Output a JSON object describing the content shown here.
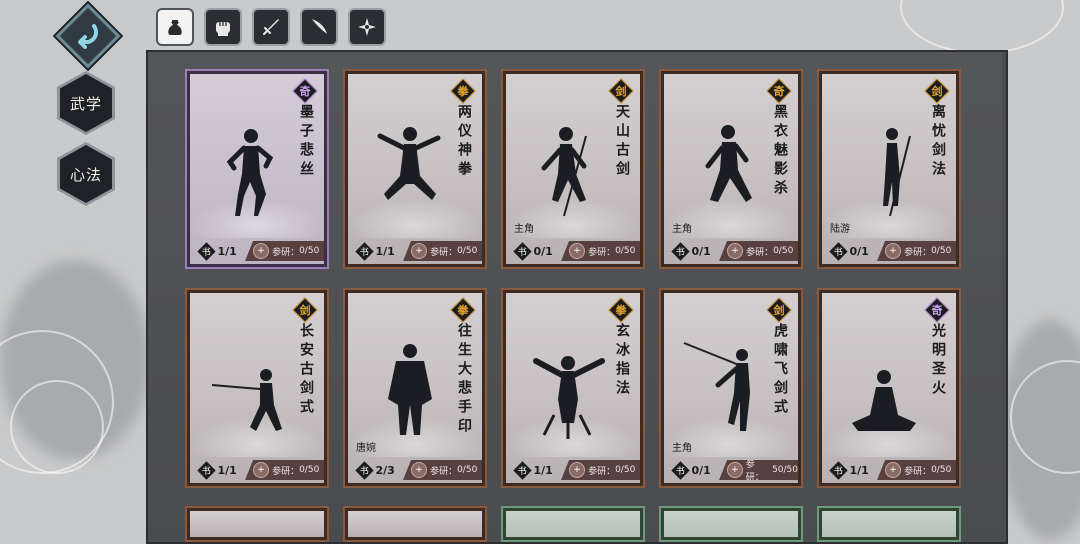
{
  "back_button": {
    "icon": "back-arrow-icon"
  },
  "filters": [
    {
      "icon": "pouch-icon",
      "selected": true
    },
    {
      "icon": "fist-icon",
      "selected": false
    },
    {
      "icon": "sword-icon",
      "selected": false
    },
    {
      "icon": "blade-icon",
      "selected": false
    },
    {
      "icon": "shuriken-icon",
      "selected": false
    }
  ],
  "categories": [
    {
      "label": "武学"
    },
    {
      "label": "心法"
    }
  ],
  "research_label": "参研：",
  "book_glyph": "书",
  "cards": [
    {
      "name": "墨子悲丝",
      "type": "奇",
      "owner": "",
      "count": "1/1",
      "research": "0/50",
      "frame": "purple"
    },
    {
      "name": "两仪神拳",
      "type": "拳",
      "owner": "",
      "count": "1/1",
      "research": "0/50",
      "frame": "bronze"
    },
    {
      "name": "天山古剑",
      "type": "剑",
      "owner": "主角",
      "count": "0/1",
      "research": "0/50",
      "frame": "bronze"
    },
    {
      "name": "黑衣魅影杀",
      "type": "奇",
      "owner": "主角",
      "count": "0/1",
      "research": "0/50",
      "frame": "bronze"
    },
    {
      "name": "离忧剑法",
      "type": "剑",
      "owner": "陆游",
      "count": "0/1",
      "research": "0/50",
      "frame": "bronze"
    },
    {
      "name": "长安古剑式",
      "type": "剑",
      "owner": "",
      "count": "1/1",
      "research": "0/50",
      "frame": "bronze"
    },
    {
      "name": "往生大悲手印",
      "type": "拳",
      "owner": "唐婉",
      "count": "2/3",
      "research": "0/50",
      "frame": "bronze"
    },
    {
      "name": "玄冰指法",
      "type": "拳",
      "owner": "",
      "count": "1/1",
      "research": "0/50",
      "frame": "bronze"
    },
    {
      "name": "虎啸飞剑式",
      "type": "剑",
      "owner": "主角",
      "count": "0/1",
      "research": "50/50",
      "frame": "bronze"
    },
    {
      "name": "光明圣火",
      "type": "奇",
      "owner": "",
      "count": "1/1",
      "research": "0/50",
      "frame": "bronze"
    }
  ],
  "colors": {
    "panel": "#4c4d50",
    "badge_gold": "#e7a62e",
    "badge_purple": "#c9a3ef",
    "research_bar": "#574040"
  }
}
